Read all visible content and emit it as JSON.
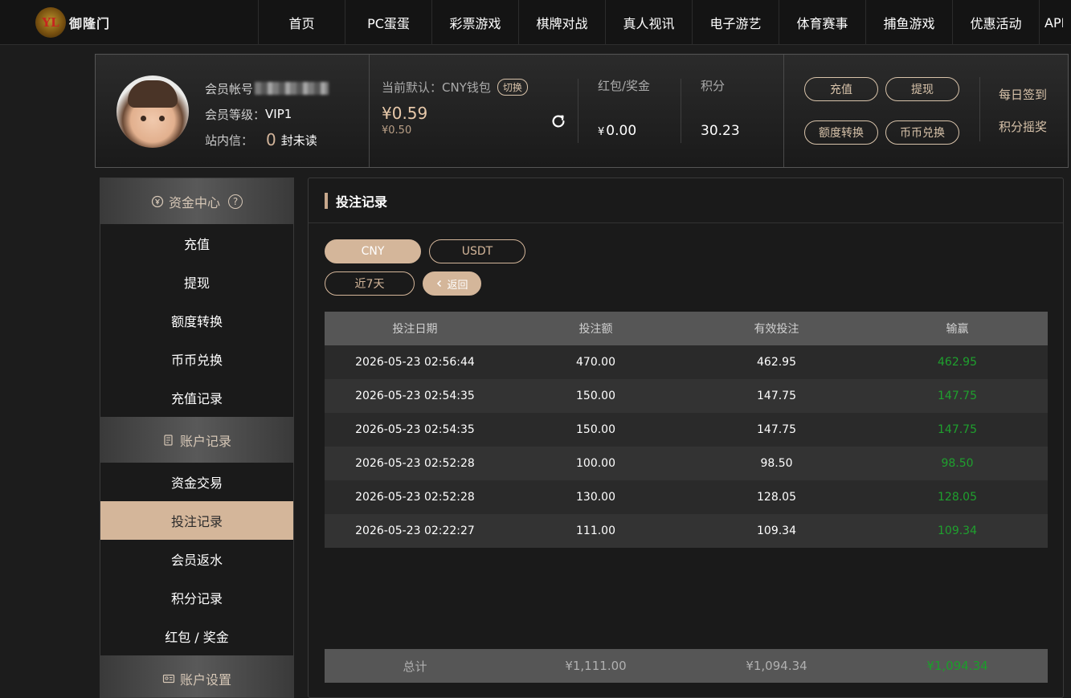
{
  "brand": {
    "name": "御隆门"
  },
  "nav": [
    "首页",
    "PC蛋蛋",
    "彩票游戏",
    "棋牌对战",
    "真人视讯",
    "电子游艺",
    "体育赛事",
    "捕鱼游戏",
    "优惠活动",
    "APP"
  ],
  "profile": {
    "account_label": "会员帐号",
    "level_label": "会员等级：",
    "level_value": "VIP1",
    "message_label": "站内信：",
    "unread_count": "0",
    "unread_suffix": "封未读"
  },
  "wallet": {
    "label": "当前默认：CNY钱包",
    "switch_label": "切换",
    "amount": "¥0.59",
    "sub_amount": "¥0.50"
  },
  "stats": {
    "bonus_label": "红包/奖金",
    "bonus_currency": "¥",
    "bonus_value": "0.00",
    "points_label": "积分",
    "points_value": "30.23"
  },
  "profile_buttons": {
    "deposit": "充值",
    "withdraw": "提现",
    "transfer": "额度转换",
    "exchange": "币币兑换",
    "daily_checkin": "每日签到",
    "points_lottery": "积分摇奖"
  },
  "menu": {
    "funds_header": "资金中心",
    "help_symbol": "?",
    "funds_items": [
      "充值",
      "提现",
      "额度转换",
      "币币兑换",
      "充值记录"
    ],
    "records_header": "账户记录",
    "records_items": [
      "资金交易",
      "投注记录",
      "会员返水",
      "积分记录",
      "红包 / 奖金"
    ],
    "settings_header": "账户设置"
  },
  "main": {
    "title": "投注记录",
    "currency_tabs": [
      "CNY",
      "USDT"
    ],
    "range_label": "近7天",
    "back_label": "返回"
  },
  "table": {
    "headers": [
      "投注日期",
      "投注额",
      "有效投注",
      "输赢"
    ],
    "rows": [
      [
        "2026-05-23 02:56:44",
        "470.00",
        "462.95",
        "462.95"
      ],
      [
        "2026-05-23 02:54:35",
        "150.00",
        "147.75",
        "147.75"
      ],
      [
        "2026-05-23 02:54:35",
        "150.00",
        "147.75",
        "147.75"
      ],
      [
        "2026-05-23 02:52:28",
        "100.00",
        "98.50",
        "98.50"
      ],
      [
        "2026-05-23 02:52:28",
        "130.00",
        "128.05",
        "128.05"
      ],
      [
        "2026-05-23 02:22:27",
        "111.00",
        "109.34",
        "109.34"
      ]
    ],
    "footer": [
      "总计",
      "¥1,111.00",
      "¥1,094.34",
      "¥1,094.34"
    ]
  },
  "colors": {
    "accent": "#d4b69a",
    "win": "#1fa02e",
    "background": "#1c1c1c"
  }
}
